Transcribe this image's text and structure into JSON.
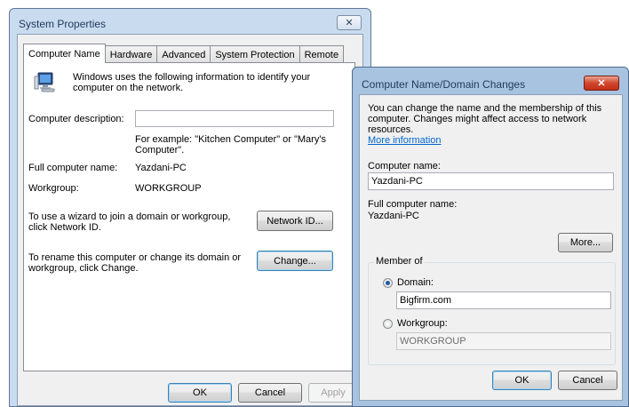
{
  "system_properties": {
    "title": "System Properties",
    "close_icon": "close-icon",
    "tabs": [
      "Computer Name",
      "Hardware",
      "Advanced",
      "System Protection",
      "Remote"
    ],
    "active_tab": "Computer Name",
    "intro_text": "Windows uses the following information to identify your computer on the network.",
    "computer_icon": "computer-icon",
    "description_label": "Computer description:",
    "description_value": "",
    "example_text": "For example: \"Kitchen Computer\" or \"Mary's Computer\".",
    "full_name_label": "Full computer name:",
    "full_name_value": "Yazdani-PC",
    "workgroup_label": "Workgroup:",
    "workgroup_value": "WORKGROUP",
    "network_id_text": "To use a wizard to join a domain or workgroup, click Network ID.",
    "network_id_button": "Network ID...",
    "change_text": "To rename this computer or change its domain or workgroup, click Change.",
    "change_button": "Change...",
    "ok_button": "OK",
    "cancel_button": "Cancel",
    "apply_button": "Apply"
  },
  "domain_changes": {
    "title": "Computer Name/Domain Changes",
    "close_icon": "close-icon",
    "intro_text": "You can change the name and the membership of this computer. Changes might affect access to network resources.",
    "more_info_link": "More information",
    "computer_name_label": "Computer name:",
    "computer_name_value": "Yazdani-PC",
    "full_name_label": "Full computer name:",
    "full_name_value": "Yazdani-PC",
    "more_button": "More...",
    "member_of_label": "Member of",
    "domain_label": "Domain:",
    "domain_value": "Bigfirm.com",
    "domain_selected": true,
    "workgroup_label": "Workgroup:",
    "workgroup_value": "WORKGROUP",
    "ok_button": "OK",
    "cancel_button": "Cancel"
  }
}
